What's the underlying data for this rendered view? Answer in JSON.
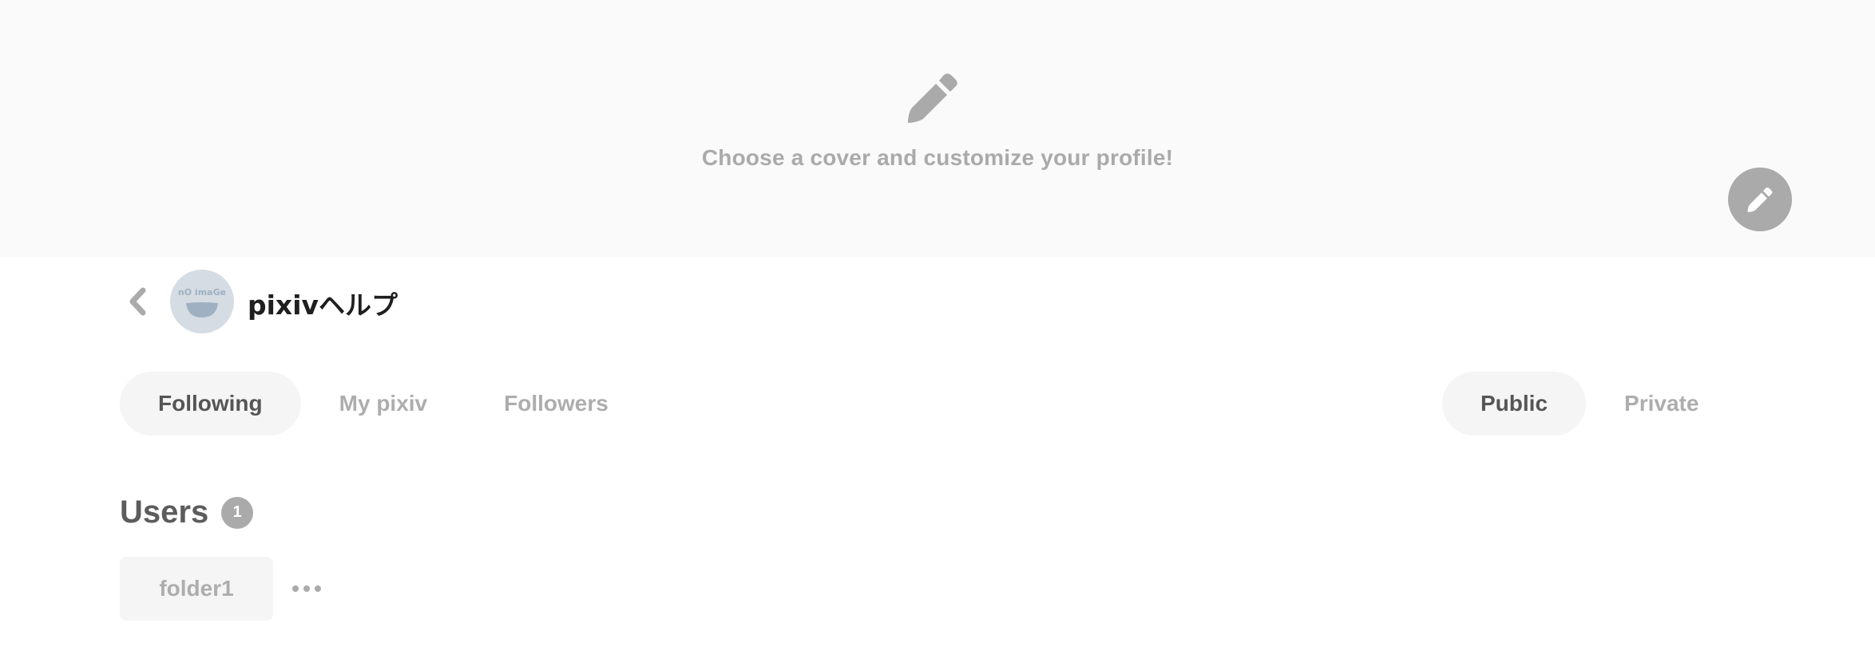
{
  "cover": {
    "icon": "pencil-icon",
    "prompt": "Choose a cover and customize your profile!",
    "edit_button_icon": "pencil-icon"
  },
  "profile": {
    "back_icon": "chevron-left-icon",
    "avatar_alt": "no image",
    "name": "pixivヘルプ"
  },
  "tabs": [
    {
      "label": "Following",
      "active": true
    },
    {
      "label": "My pixiv",
      "active": false
    },
    {
      "label": "Followers",
      "active": false
    }
  ],
  "visibility": [
    {
      "label": "Public",
      "active": true
    },
    {
      "label": "Private",
      "active": false
    }
  ],
  "section": {
    "title": "Users",
    "count": "1"
  },
  "folders": [
    {
      "label": "folder1"
    }
  ],
  "more_icon": "ellipsis-icon",
  "colors": {
    "banner_bg": "#fafafa",
    "pill_bg": "#f5f5f5",
    "icon_gray": "#aaaaaa",
    "active_text": "#555555",
    "inactive_text": "#adadad"
  }
}
